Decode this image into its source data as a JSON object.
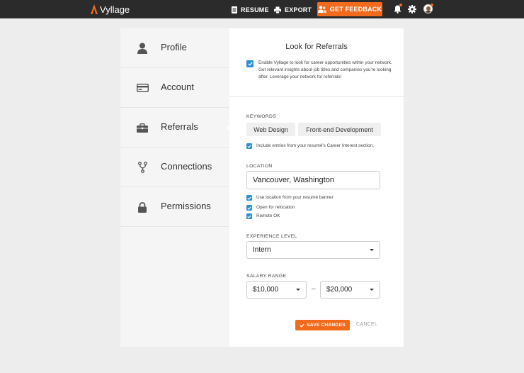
{
  "app": {
    "name": "Vyllage"
  },
  "topbar": {
    "resume_label": "RESUME",
    "export_label": "EXPORT",
    "feedback_label": "GET FEEDBACK"
  },
  "sidebar": {
    "items": [
      {
        "label": "Profile",
        "icon": "person-icon"
      },
      {
        "label": "Account",
        "icon": "credit-card-icon"
      },
      {
        "label": "Referrals",
        "icon": "briefcase-icon",
        "active": true
      },
      {
        "label": "Connections",
        "icon": "fork-icon"
      },
      {
        "label": "Permissions",
        "icon": "lock-icon"
      }
    ]
  },
  "referrals": {
    "title": "Look for Referrals",
    "enable_checked": true,
    "enable_text": "Enable Vyllage to look for career opportunities within your network. Get relevant insights about job titles and companies you're looking after. Leverage your network for referrals!",
    "keywords_label": "KEYWORDS",
    "keywords": [
      "Web Design",
      "Front-end Development"
    ],
    "include_entries_label": "Include entries from your resumé's Career Interest section.",
    "location_label": "LOCATION",
    "location_value": "Vancouver, Washington",
    "use_location_label": "Use location from your resumé banner",
    "open_relocation_label": "Open for relocation",
    "remote_label": "Remote OK",
    "experience_label": "EXPERIENCE LEVEL",
    "experience_value": "Intern",
    "salary_label": "SALARY RANGE",
    "salary_min": "$10,000",
    "salary_dash": "–",
    "salary_max": "$20,000",
    "save_label": "SAVE CHANGES",
    "cancel_label": "CANCEL"
  },
  "colors": {
    "accent": "#f26b1d",
    "checkbox": "#2a8fd6",
    "topbar": "#2b2b2b"
  }
}
